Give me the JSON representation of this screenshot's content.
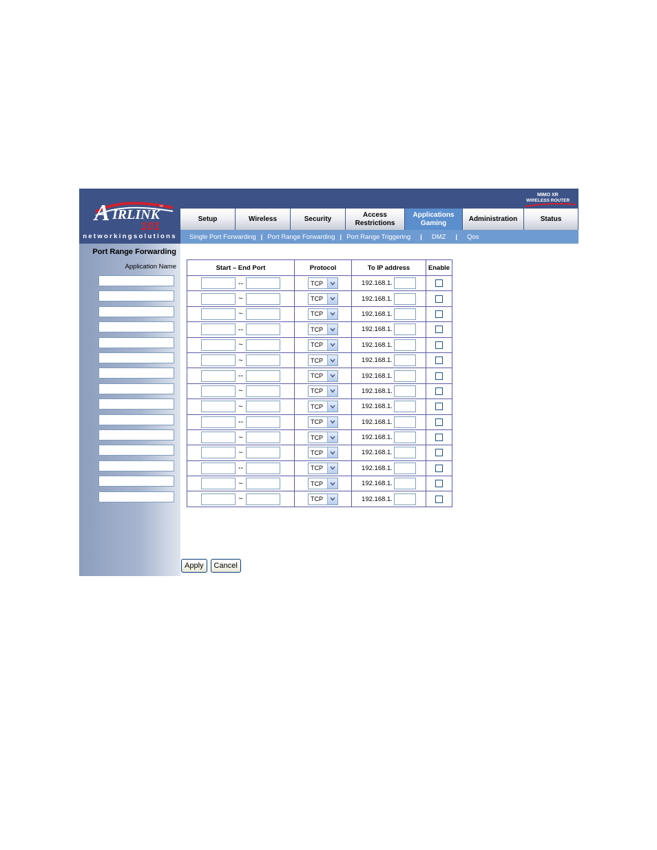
{
  "header": {
    "logo_text": "AIRLINK 101",
    "tagline": "networkingsolutions",
    "brand_line1": "MIMO XR",
    "brand_line2": "WIRELESS ROUTER"
  },
  "nav": {
    "tabs": [
      {
        "label": "Setup"
      },
      {
        "label": "Wireless"
      },
      {
        "label": "Security"
      },
      {
        "label": "Access\nRestrictions"
      },
      {
        "label": "Applications\nGaming",
        "active": true
      },
      {
        "label": "Administration"
      },
      {
        "label": "Status"
      }
    ]
  },
  "subnav": {
    "items": [
      "Single Port Forwarding",
      "Port Range Forwarding",
      "Port Range Triggering",
      "DMZ",
      "Qos"
    ],
    "separator": "|"
  },
  "sidebar": {
    "title": "Port Range Forwarding",
    "app_name_label": "Application Name"
  },
  "table": {
    "headers": [
      "Start – End Port",
      "Protocol",
      "To IP address",
      "Enable"
    ],
    "ip_prefix": "192.168.1.",
    "protocol_default": "TCP",
    "rows": [
      {
        "sep": "--"
      },
      {
        "sep": "~"
      },
      {
        "sep": "~"
      },
      {
        "sep": "--"
      },
      {
        "sep": "~"
      },
      {
        "sep": "~"
      },
      {
        "sep": "--"
      },
      {
        "sep": "~"
      },
      {
        "sep": "~"
      },
      {
        "sep": "--"
      },
      {
        "sep": "~"
      },
      {
        "sep": "~"
      },
      {
        "sep": "--"
      },
      {
        "sep": "~"
      },
      {
        "sep": "~"
      }
    ]
  },
  "buttons": {
    "apply": "Apply",
    "cancel": "Cancel"
  },
  "colors": {
    "header_bg": "#3d5387",
    "active_tab": "#5b8ecd",
    "subnav_bg": "#6e9bd1",
    "logo_red": "#d0202e",
    "table_border": "#5a5aa8"
  },
  "icons": {
    "dropdown": "chevron-down-icon",
    "logo": "airlink-logo-icon"
  }
}
